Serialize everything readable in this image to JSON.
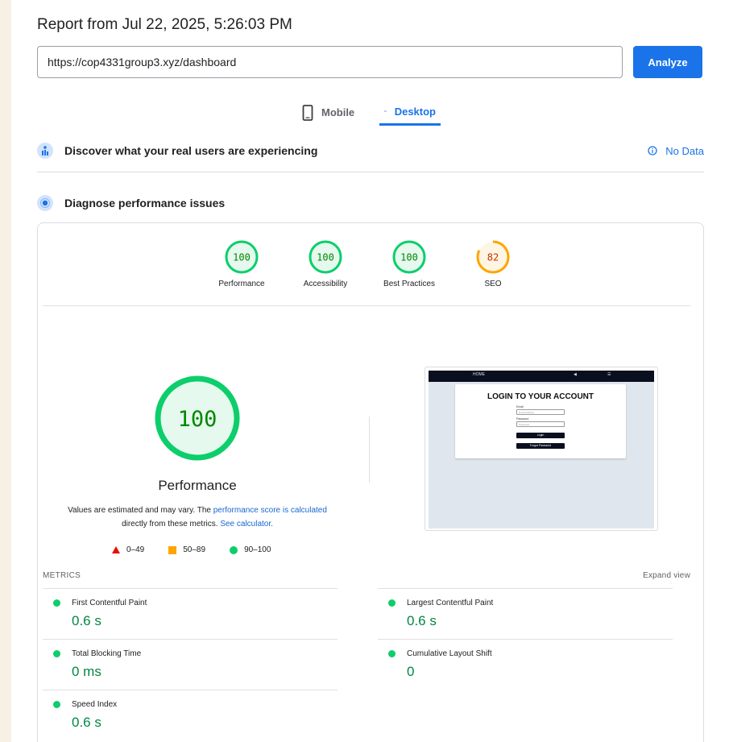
{
  "header": {
    "title": "Report from Jul 22, 2025, 5:26:03 PM",
    "url_value": "https://cop4331group3.xyz/dashboard",
    "analyze_label": "Analyze"
  },
  "tabs": [
    {
      "label": "Mobile",
      "icon": "mobile-icon",
      "active": false
    },
    {
      "label": "Desktop",
      "icon": "desktop-icon",
      "active": true
    }
  ],
  "sections": {
    "real_users": {
      "label": "Discover what your real users are experiencing",
      "status": "No Data",
      "status_icon": "info-icon"
    },
    "diagnose": {
      "label": "Diagnose performance issues"
    }
  },
  "scores": [
    {
      "label": "Performance",
      "value": "100",
      "level": 1.0,
      "color": "#0cce6b"
    },
    {
      "label": "Accessibility",
      "value": "100",
      "level": 1.0,
      "color": "#0cce6b"
    },
    {
      "label": "Best Practices",
      "value": "100",
      "level": 1.0,
      "color": "#0cce6b"
    },
    {
      "label": "SEO",
      "value": "82",
      "level": 0.82,
      "color": "#ffa400"
    }
  ],
  "performance": {
    "value": "100",
    "title": "Performance",
    "desc_prefix": "Values are estimated and may vary. The ",
    "desc_link1": "performance score is calculated",
    "desc_middle": " directly from these metrics. ",
    "desc_link2": "See calculator."
  },
  "legend": [
    {
      "label": "0–49",
      "shape": "triangle",
      "color": "#eb0f00"
    },
    {
      "label": "50–89",
      "shape": "square",
      "color": "#ffa400"
    },
    {
      "label": "90–100",
      "shape": "circle",
      "color": "#0cce6b"
    }
  ],
  "screenshot": {
    "nav_home": "HOME",
    "heading": "LOGIN TO YOUR ACCOUNT",
    "email_label": "Email",
    "email_placeholder": "Email Address",
    "password_label": "Password",
    "password_placeholder": "Password",
    "login_button": "Login",
    "forgot_button": "Forgot Password"
  },
  "metrics": {
    "heading": "METRICS",
    "expand_label": "Expand view",
    "items": [
      {
        "name": "First Contentful Paint",
        "value": "0.6 s"
      },
      {
        "name": "Largest Contentful Paint",
        "value": "0.6 s"
      },
      {
        "name": "Total Blocking Time",
        "value": "0 ms"
      },
      {
        "name": "Cumulative Layout Shift",
        "value": "0"
      },
      {
        "name": "Speed Index",
        "value": "0.6 s"
      }
    ]
  }
}
